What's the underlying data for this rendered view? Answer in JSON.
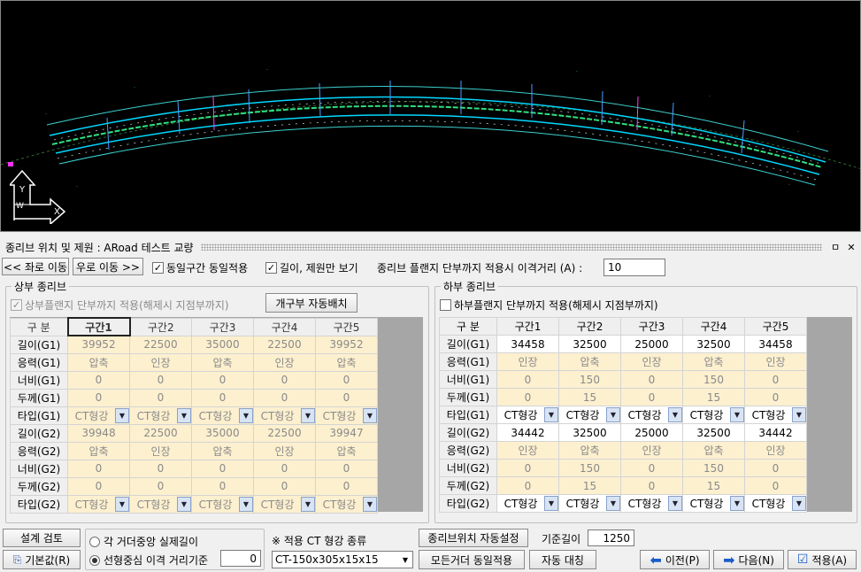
{
  "panel": {
    "title": "종리브 위치 및 제원 : ARoad 테스트 교량",
    "pin": "ㅁ",
    "close": "✕"
  },
  "toolbar": {
    "left_btn": "<< 좌로 이동",
    "right_btn": "우로 이동 >>",
    "same_section": "동일구간 동일적용",
    "length_only": "길이, 제원만 보기",
    "gap_label": "종리브 플랜지 단부까지 적용시 이격거리 (A) :",
    "gap_value": "10"
  },
  "upper": {
    "group_label": "상부 종리브",
    "flange_chk": "상부플랜지 단부까지 적용(해제시 지점부까지)",
    "auto_btn": "개구부 자동배치",
    "headers": [
      "구 분",
      "구간1",
      "구간2",
      "구간3",
      "구간4",
      "구간5"
    ],
    "rows": [
      {
        "label": "길이(G1)",
        "values": [
          "39952",
          "22500",
          "35000",
          "22500",
          "39952"
        ]
      },
      {
        "label": "응력(G1)",
        "values": [
          "압축",
          "인장",
          "압축",
          "인장",
          "압축"
        ]
      },
      {
        "label": "너비(G1)",
        "values": [
          "0",
          "0",
          "0",
          "0",
          "0"
        ]
      },
      {
        "label": "두께(G1)",
        "values": [
          "0",
          "0",
          "0",
          "0",
          "0"
        ]
      },
      {
        "label": "타입(G1)",
        "values": [
          "CT형강",
          "CT형강",
          "CT형강",
          "CT형강",
          "CT형강"
        ]
      },
      {
        "label": "길이(G2)",
        "values": [
          "39948",
          "22500",
          "35000",
          "22500",
          "39947"
        ]
      },
      {
        "label": "응력(G2)",
        "values": [
          "압축",
          "인장",
          "압축",
          "인장",
          "압축"
        ]
      },
      {
        "label": "너비(G2)",
        "values": [
          "0",
          "0",
          "0",
          "0",
          "0"
        ]
      },
      {
        "label": "두께(G2)",
        "values": [
          "0",
          "0",
          "0",
          "0",
          "0"
        ]
      },
      {
        "label": "타입(G2)",
        "values": [
          "CT형강",
          "CT형강",
          "CT형강",
          "CT형강",
          "CT형강"
        ]
      }
    ]
  },
  "lower": {
    "group_label": "하부 종리브",
    "flange_chk": "하부플랜지 단부까지 적용(해제시 지점부까지)",
    "headers": [
      "구 분",
      "구간1",
      "구간2",
      "구간3",
      "구간4",
      "구간5"
    ],
    "rows": [
      {
        "label": "길이(G1)",
        "values": [
          "34458",
          "32500",
          "25000",
          "32500",
          "34458"
        ]
      },
      {
        "label": "응력(G1)",
        "values": [
          "인장",
          "압축",
          "인장",
          "압축",
          "인장"
        ]
      },
      {
        "label": "너비(G1)",
        "values": [
          "0",
          "150",
          "0",
          "150",
          "0"
        ]
      },
      {
        "label": "두께(G1)",
        "values": [
          "0",
          "15",
          "0",
          "15",
          "0"
        ]
      },
      {
        "label": "타입(G1)",
        "values": [
          "CT형강",
          "CT형강",
          "CT형강",
          "CT형강",
          "CT형강"
        ]
      },
      {
        "label": "길이(G2)",
        "values": [
          "34442",
          "32500",
          "25000",
          "32500",
          "34442"
        ]
      },
      {
        "label": "응력(G2)",
        "values": [
          "인장",
          "압축",
          "인장",
          "압축",
          "인장"
        ]
      },
      {
        "label": "너비(G2)",
        "values": [
          "0",
          "150",
          "0",
          "150",
          "0"
        ]
      },
      {
        "label": "두께(G2)",
        "values": [
          "0",
          "15",
          "0",
          "15",
          "0"
        ]
      },
      {
        "label": "타입(G2)",
        "values": [
          "CT형강",
          "CT형강",
          "CT형강",
          "CT형강",
          "CT형강"
        ]
      }
    ]
  },
  "bottom": {
    "design_check": "설계 검토",
    "default_btn": "기본값(R)",
    "radio1": "각 거더중앙 실제길이",
    "radio2": "선형중심 이격 거리기준",
    "radio2_value": "0",
    "ct_label": "※ 적용 CT 형강 종류",
    "ct_value": "CT-150x305x15x15",
    "auto_pos_btn": "종리브위치 자동설정",
    "base_len_label": "기준길이",
    "base_len_value": "1250",
    "all_girder_btn": "모든거더 동일적용",
    "auto_sym_btn": "자동 대칭",
    "prev_btn": "이전(P)",
    "next_btn": "다음(N)",
    "apply_btn": "적용(A)"
  },
  "cad": {
    "axis_x": "X",
    "axis_y": "Y",
    "axis_w": "W"
  }
}
